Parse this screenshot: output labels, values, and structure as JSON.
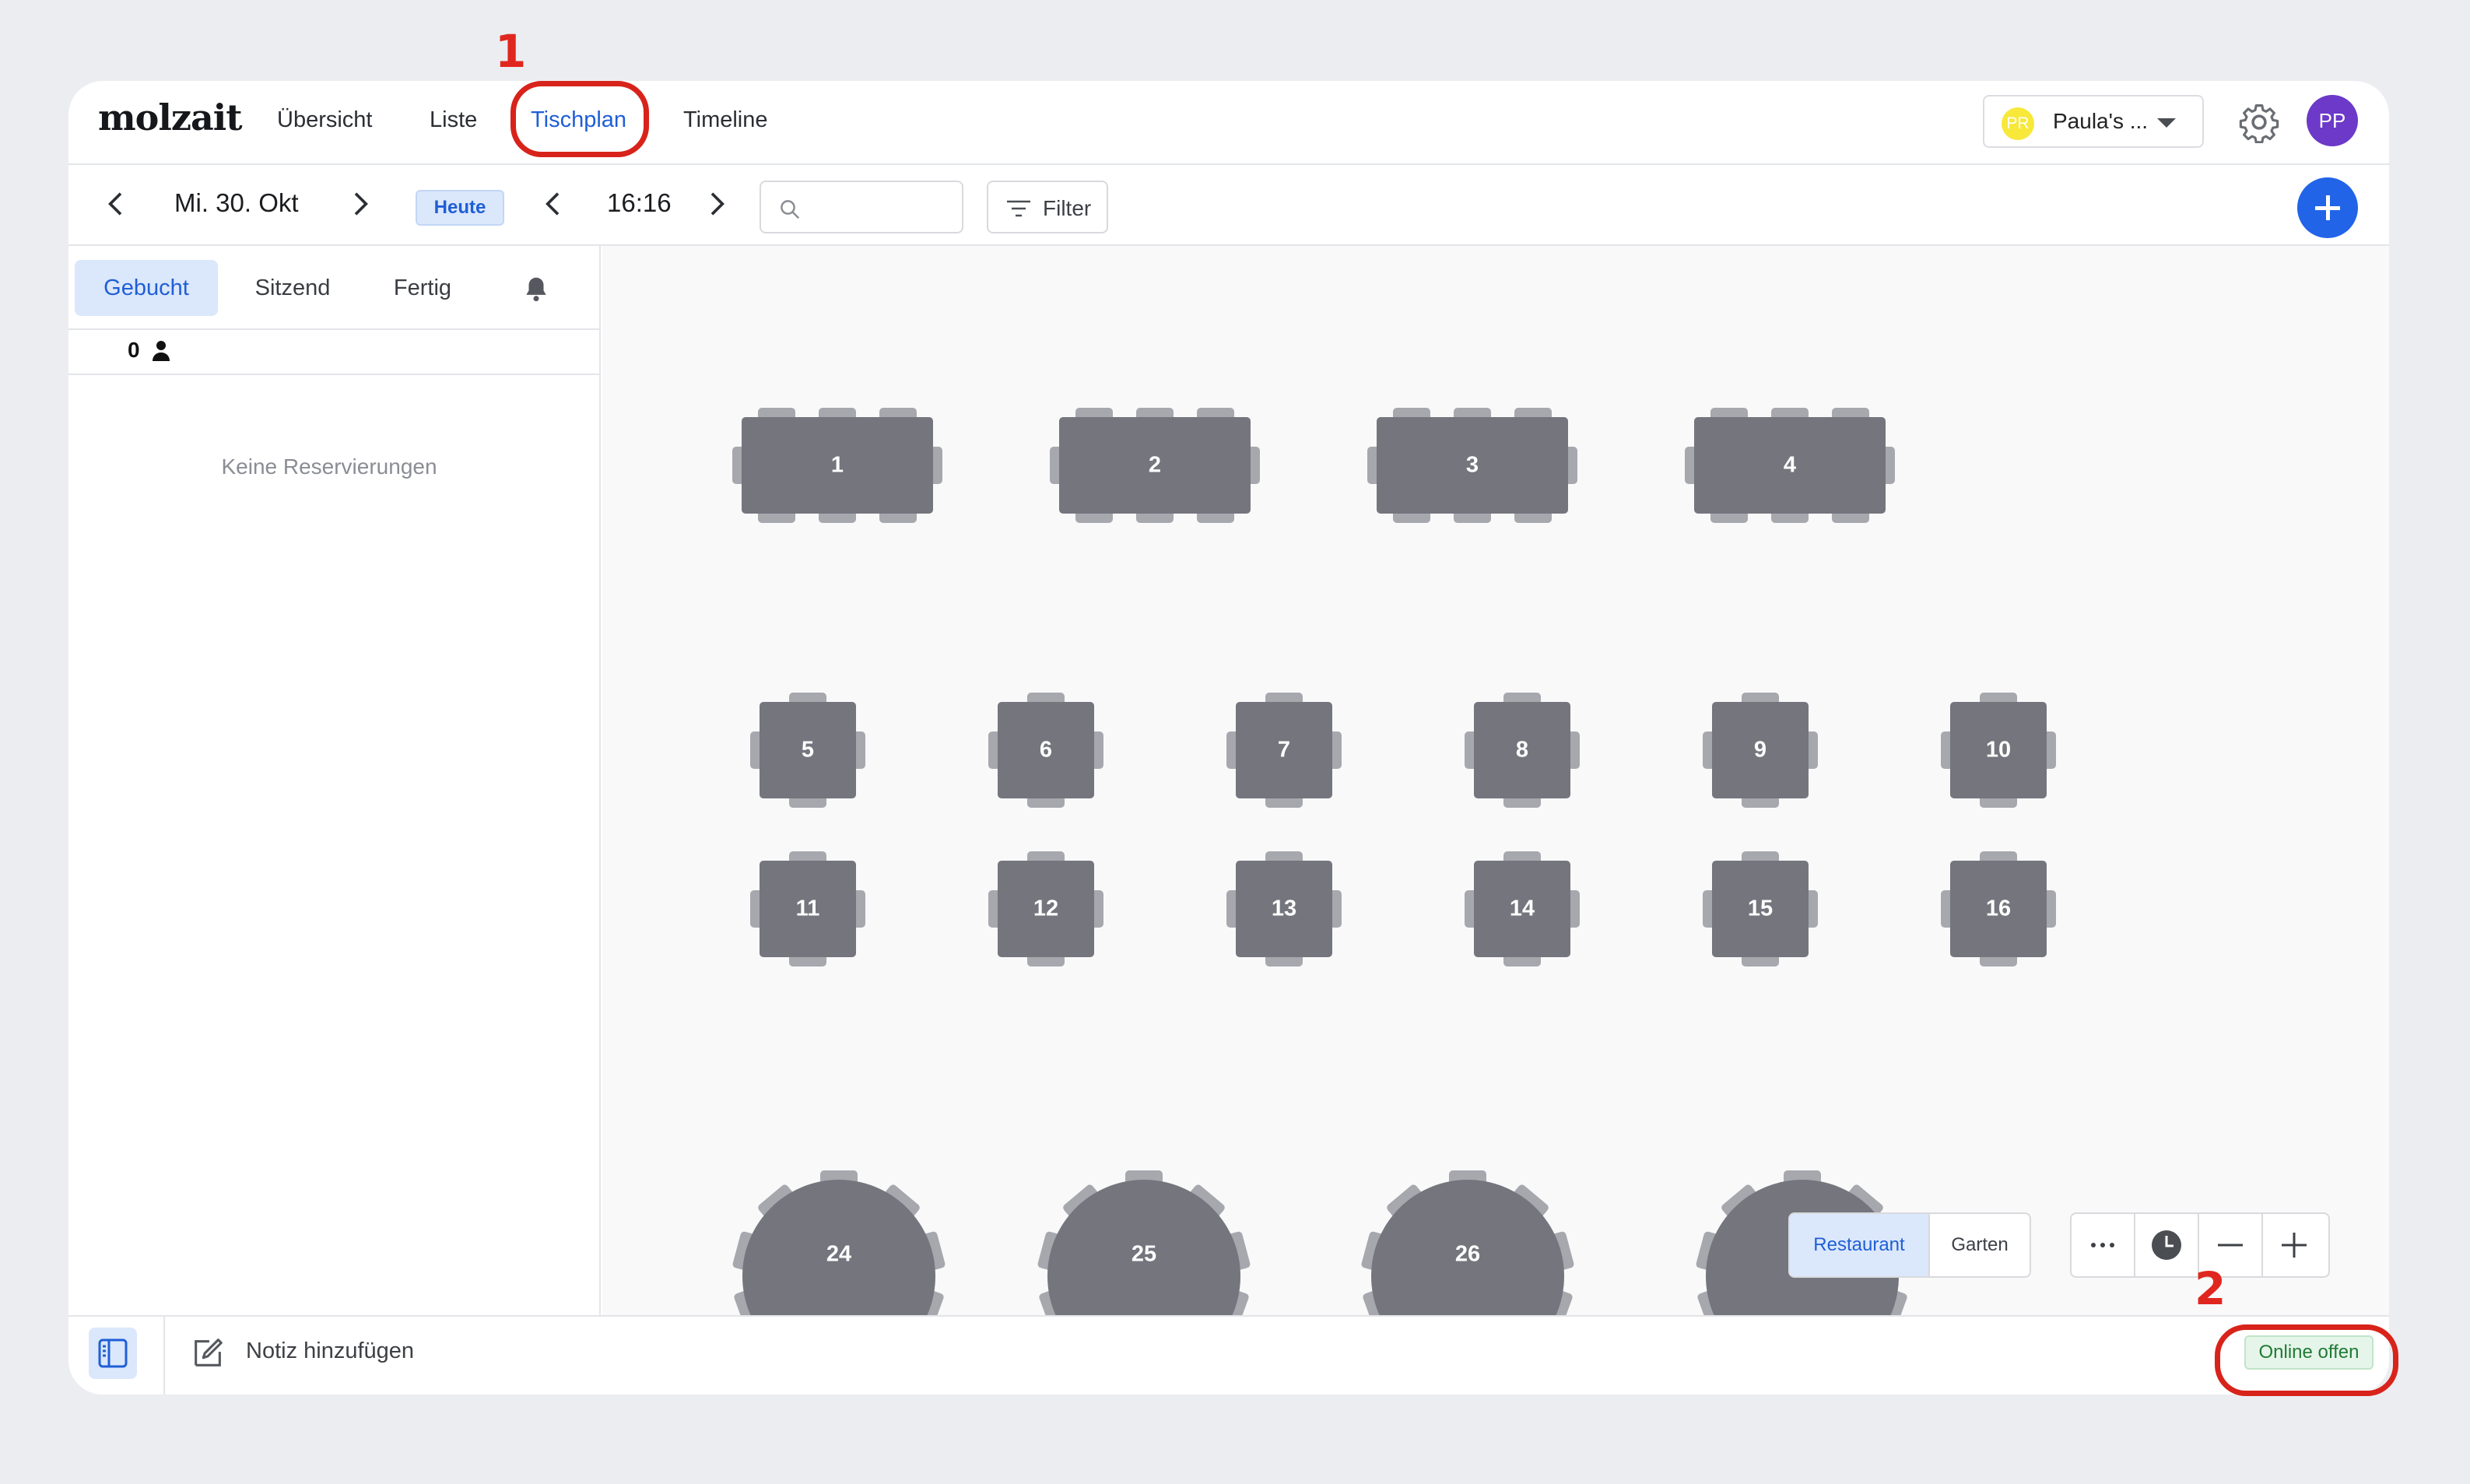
{
  "app": {
    "logo": "molzait"
  },
  "nav": {
    "tabs": [
      {
        "label": "Übersicht",
        "active": false
      },
      {
        "label": "Liste",
        "active": false
      },
      {
        "label": "Tischplan",
        "active": true
      },
      {
        "label": "Timeline",
        "active": false
      }
    ],
    "account": {
      "initials": "PR",
      "name": "Paula's ..."
    },
    "user": {
      "initials": "PP"
    }
  },
  "toolbar": {
    "date": "Mi. 30. Okt",
    "today_label": "Heute",
    "time": "16:16",
    "search_placeholder": "",
    "filter_label": "Filter"
  },
  "sidebar": {
    "tabs": [
      {
        "label": "Gebucht",
        "active": true
      },
      {
        "label": "Sitzend",
        "active": false
      },
      {
        "label": "Fertig",
        "active": false
      }
    ],
    "guest_count": "0",
    "empty_message": "Keine Reservierungen"
  },
  "floor": {
    "tables": [
      "1",
      "2",
      "3",
      "4",
      "5",
      "6",
      "7",
      "8",
      "9",
      "10",
      "11",
      "12",
      "13",
      "14",
      "15",
      "16",
      "24",
      "25",
      "26"
    ],
    "areas": [
      {
        "label": "Restaurant",
        "active": true
      },
      {
        "label": "Garten",
        "active": false
      }
    ]
  },
  "bottombar": {
    "note_label": "Notiz hinzufügen",
    "online_status": "Online offen"
  },
  "annotations": {
    "first": "1",
    "second": "2"
  },
  "colors": {
    "accent": "#2164e8",
    "active_bg": "#dbe7fb",
    "table_fill": "#74757d",
    "chair_fill": "#a7a8ae",
    "annotation": "#d8231b",
    "online_green": "#207a36"
  }
}
